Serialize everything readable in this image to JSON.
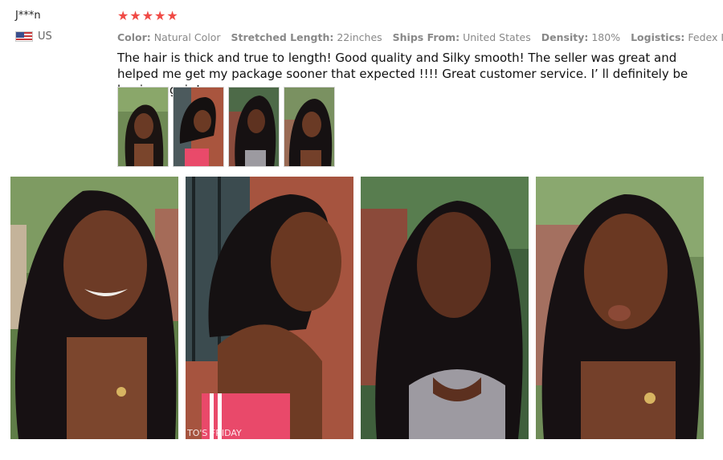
{
  "reviewer": {
    "name": "J***n",
    "country": "US",
    "flag_icon": "us-flag-icon"
  },
  "rating": {
    "stars": 5,
    "star_color": "#f04a45"
  },
  "attributes": [
    {
      "key": "Color:",
      "value": "Natural Color"
    },
    {
      "key": "Stretched Length:",
      "value": "22inches"
    },
    {
      "key": "Ships From:",
      "value": "United States"
    },
    {
      "key": "Density:",
      "value": "180%"
    },
    {
      "key": "Logistics:",
      "value": "Fedex IP"
    }
  ],
  "review_text": "The hair is thick and true to length! Good quality and Silky smooth! The seller was great and helped me get my package sooner that expected !!!! Great customer service. I’ ll definitely be buying again!",
  "photo_overlay_text": "TO'S FRIDAY"
}
